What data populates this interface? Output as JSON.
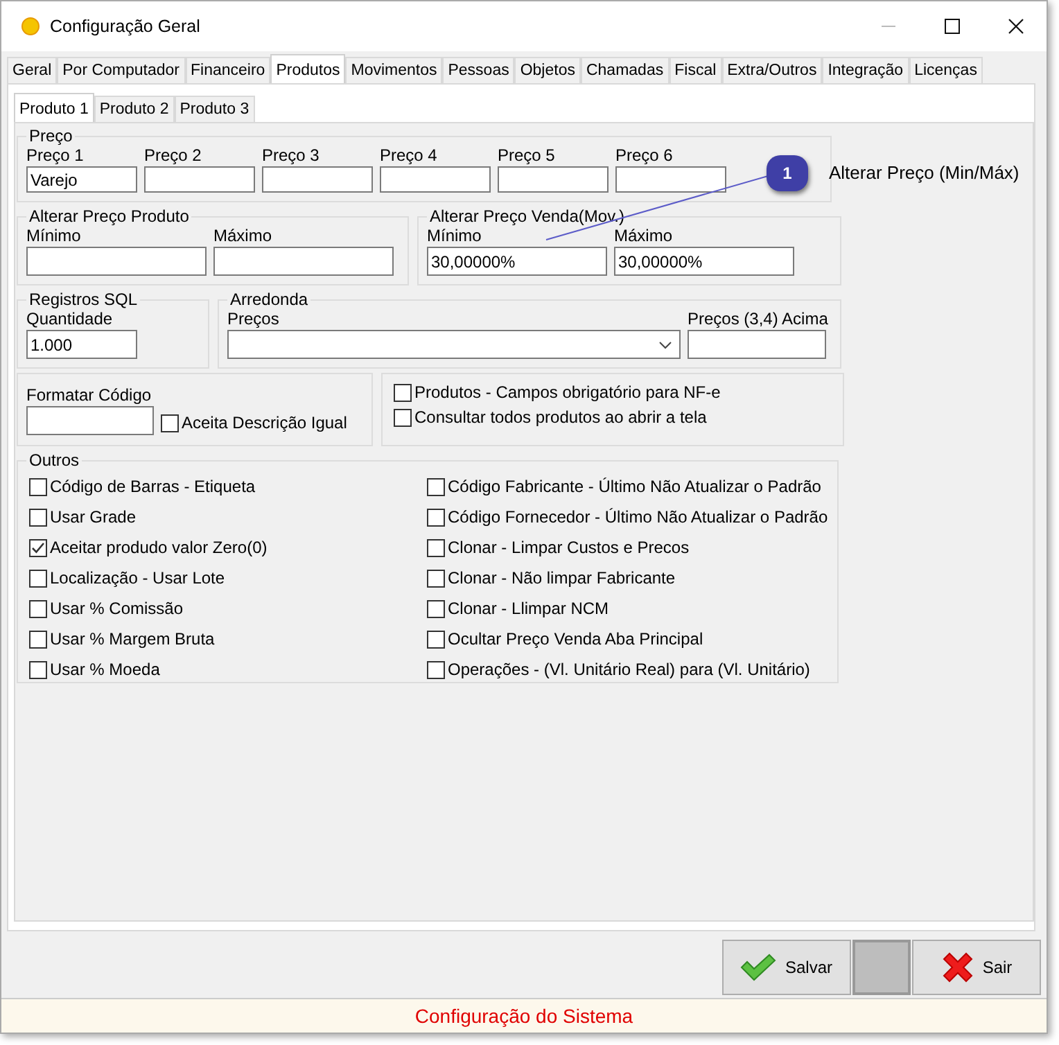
{
  "window": {
    "title": "Configuração Geral"
  },
  "main_tabs": [
    {
      "label": "Geral",
      "selected": false
    },
    {
      "label": "Por Computador",
      "selected": false
    },
    {
      "label": "Financeiro",
      "selected": false
    },
    {
      "label": "Produtos",
      "selected": true
    },
    {
      "label": "Movimentos",
      "selected": false
    },
    {
      "label": "Pessoas",
      "selected": false
    },
    {
      "label": "Objetos",
      "selected": false
    },
    {
      "label": "Chamadas",
      "selected": false
    },
    {
      "label": "Fiscal",
      "selected": false
    },
    {
      "label": "Extra/Outros",
      "selected": false
    },
    {
      "label": "Integração",
      "selected": false
    },
    {
      "label": "Licenças",
      "selected": false
    }
  ],
  "sub_tabs": [
    {
      "label": "Produto 1",
      "selected": true
    },
    {
      "label": "Produto 2",
      "selected": false
    },
    {
      "label": "Produto 3",
      "selected": false
    }
  ],
  "preco": {
    "title": "Preço",
    "fields": [
      {
        "label": "Preço 1",
        "value": "Varejo"
      },
      {
        "label": "Preço 2"
      },
      {
        "label": "Preço 3"
      },
      {
        "label": "Preço 4"
      },
      {
        "label": "Preço 5"
      },
      {
        "label": "Preço 6"
      }
    ]
  },
  "callout": {
    "number": "1",
    "text": "Alterar Preço (Min/Máx)"
  },
  "alterar_preco_produto": {
    "title": "Alterar Preço Produto",
    "fields": [
      {
        "label": "Mínimo"
      },
      {
        "label": "Máximo"
      }
    ]
  },
  "alterar_preco_venda": {
    "title": "Alterar Preço Venda(Mov.)",
    "fields": [
      {
        "label": "Mínimo",
        "value": "30,00000%"
      },
      {
        "label": "Máximo",
        "value": "30,00000%"
      }
    ]
  },
  "registros_sql": {
    "title": "Registros SQL",
    "label": "Quantidade",
    "value": "1.000"
  },
  "arredonda": {
    "title": "Arredonda",
    "precos_label": "Preços",
    "acima_label": "Preços (3,4) Acima"
  },
  "formatar_codigo": {
    "label": "Formatar Código",
    "checkbox": {
      "label": "Aceita Descrição Igual",
      "checked": false
    }
  },
  "nfe_options": [
    {
      "label": "Produtos - Campos obrigatório para NF-e",
      "checked": false
    },
    {
      "label": "Consultar todos produtos ao abrir a tela",
      "checked": false
    }
  ],
  "outros": {
    "title": "Outros",
    "left": [
      {
        "label": "Código de Barras - Etiqueta",
        "checked": false
      },
      {
        "label": "Usar Grade",
        "checked": false
      },
      {
        "label": "Aceitar produdo valor Zero(0)",
        "checked": true
      },
      {
        "label": "Localização - Usar Lote",
        "checked": false
      },
      {
        "label": "Usar % Comissão",
        "checked": false
      },
      {
        "label": "Usar % Margem Bruta",
        "checked": false
      },
      {
        "label": "Usar % Moeda",
        "checked": false
      }
    ],
    "right": [
      {
        "label": "Código Fabricante - Último Não Atualizar o Padrão",
        "checked": false
      },
      {
        "label": "Código Fornecedor - Último Não Atualizar o Padrão",
        "checked": false
      },
      {
        "label": "Clonar - Limpar Custos e Precos",
        "checked": false
      },
      {
        "label": "Clonar - Não limpar Fabricante",
        "checked": false
      },
      {
        "label": "Clonar - Llimpar NCM",
        "checked": false
      },
      {
        "label": "Ocultar Preço Venda Aba Principal",
        "checked": false
      },
      {
        "label": "Operações - (Vl. Unitário Real) para (Vl. Unitário)",
        "checked": false
      }
    ]
  },
  "buttons": [
    {
      "label": "Salvar",
      "kind": "save"
    },
    {
      "kind": "blank"
    },
    {
      "label": "Sair",
      "kind": "exit"
    }
  ],
  "status_bar": "Configuração do Sistema"
}
